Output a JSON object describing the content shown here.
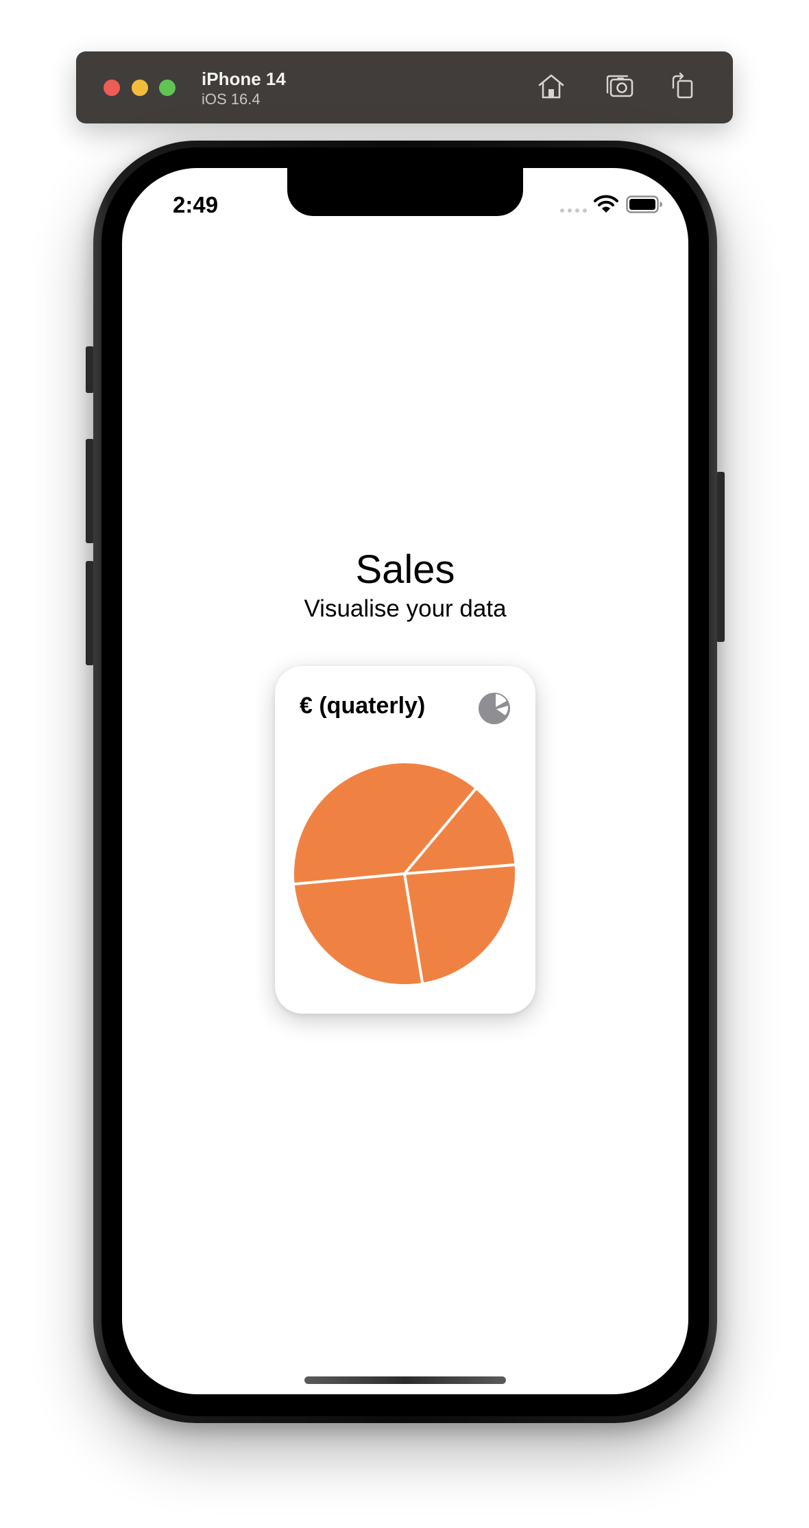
{
  "simulator": {
    "device_name": "iPhone 14",
    "os_version": "iOS 16.4",
    "buttons": [
      "home",
      "screenshot",
      "rotate"
    ]
  },
  "status_bar": {
    "time": "2:49"
  },
  "page": {
    "title": "Sales",
    "subtitle": "Visualise your data"
  },
  "card": {
    "title": "€ (quaterly)",
    "icon": "pie-chart-icon"
  },
  "colors": {
    "slice": "#ef8243",
    "separator": "#ffffff",
    "icon_gray": "#8e8e93"
  },
  "chart_data": {
    "type": "pie",
    "title": "",
    "values": [
      12.6,
      23.7,
      26.1,
      37.6
    ]
  }
}
